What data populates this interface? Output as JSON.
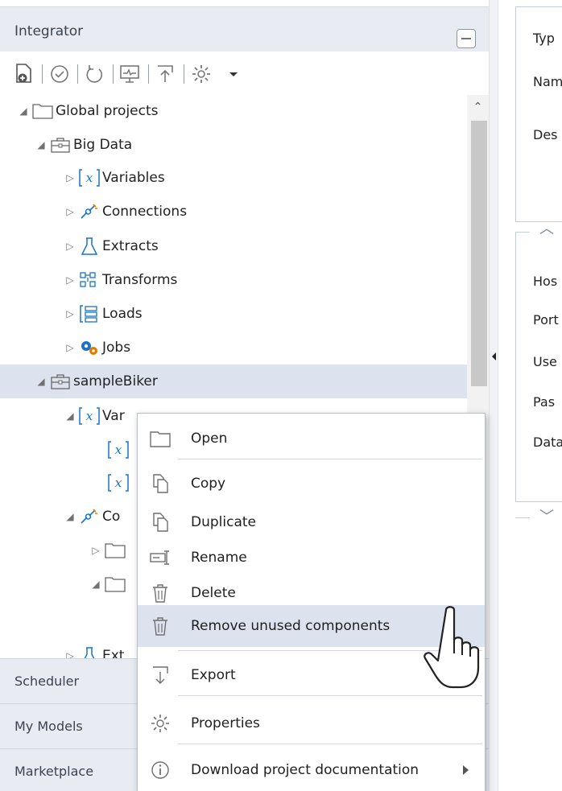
{
  "left_panel": {
    "title": "Integrator",
    "bottom_tabs": [
      "Scheduler",
      "My Models",
      "Marketplace"
    ]
  },
  "toolbar": {
    "icons": [
      "new-project-icon",
      "check-circle-icon",
      "refresh-icon",
      "monitor-icon",
      "publish-icon",
      "gear-icon",
      "dropdown-arrow-icon"
    ]
  },
  "tree": {
    "global_projects": "Global projects",
    "big_data": "Big Data",
    "variables": "Variables",
    "connections": "Connections",
    "extracts": "Extracts",
    "transforms": "Transforms",
    "loads": "Loads",
    "jobs": "Jobs",
    "sample_biker": "sampleBiker",
    "var_partial": "Var",
    "con_partial": "Co",
    "ext_partial": "Ext"
  },
  "context_menu": {
    "open": "Open",
    "copy": "Copy",
    "duplicate": "Duplicate",
    "rename": "Rename",
    "delete": "Delete",
    "remove_unused": "Remove unused components",
    "export": "Export",
    "properties": "Properties",
    "download_docs": "Download project documentation"
  },
  "right_panel": {
    "labels": [
      "Typ",
      "Nam",
      "Des",
      "Hos",
      "Port",
      "Use",
      "Pas",
      "Data"
    ]
  },
  "colors": {
    "header_bg": "#e8ecf2",
    "selection_bg": "#dde3ee",
    "accent_blue": "#1a73c8"
  }
}
